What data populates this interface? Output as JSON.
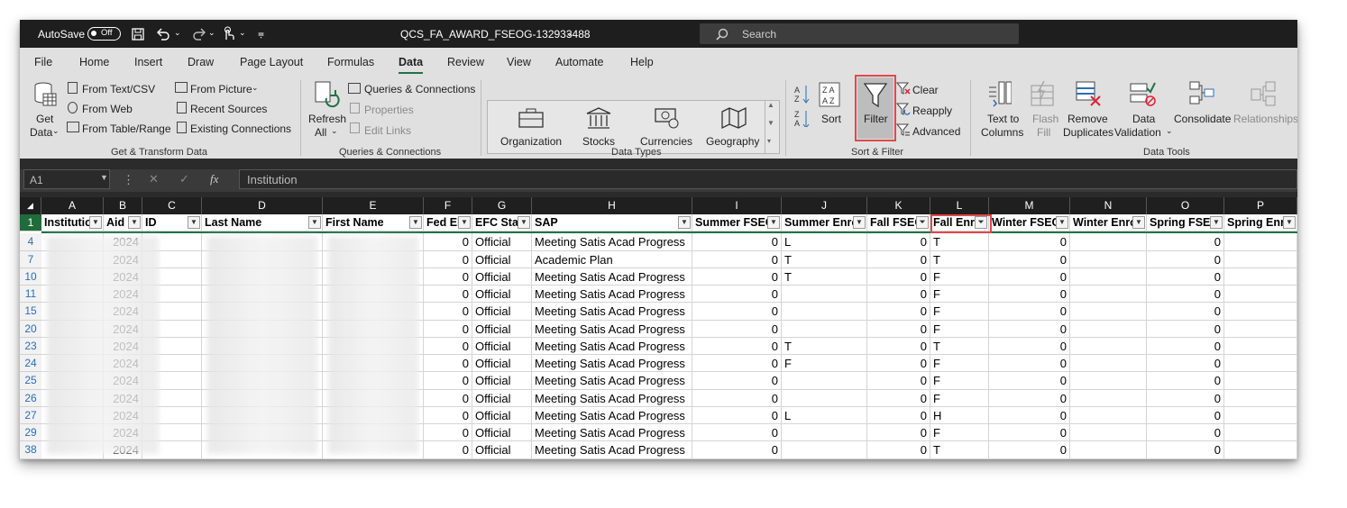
{
  "titlebar": {
    "autosave_label": "AutoSave",
    "autosave_state": "Off",
    "filename": "QCS_FA_AWARD_FSEOG-132933488",
    "search_placeholder": "Search"
  },
  "menu": [
    "File",
    "Home",
    "Insert",
    "Draw",
    "Page Layout",
    "Formulas",
    "Data",
    "Review",
    "View",
    "Automate",
    "Help"
  ],
  "active_tab": "Data",
  "ribbon": {
    "get_transform": {
      "get_data": "Get",
      "get_data2": "Data",
      "from_text_csv": "From Text/CSV",
      "from_web": "From Web",
      "from_table_range": "From Table/Range",
      "from_picture": "From Picture",
      "recent_sources": "Recent Sources",
      "existing_connections": "Existing Connections",
      "label": "Get & Transform Data"
    },
    "queries": {
      "refresh": "Refresh",
      "refresh2": "All",
      "queries_connections": "Queries & Connections",
      "properties": "Properties",
      "edit_links": "Edit Links",
      "label": "Queries & Connections"
    },
    "data_types": {
      "items": [
        "Organization",
        "Stocks",
        "Currencies",
        "Geography"
      ],
      "label": "Data Types"
    },
    "sort_filter": {
      "sort": "Sort",
      "filter": "Filter",
      "clear": "Clear",
      "reapply": "Reapply",
      "advanced": "Advanced",
      "label": "Sort & Filter"
    },
    "data_tools": {
      "text_to_columns": "Text to",
      "text_to_columns2": "Columns",
      "flash_fill": "Flash",
      "flash_fill2": "Fill",
      "remove_duplicates": "Remove",
      "remove_duplicates2": "Duplicates",
      "data_validation": "Data",
      "data_validation2": "Validation",
      "consolidate": "Consolidate",
      "relationships": "Relationships",
      "label": "Data Tools"
    }
  },
  "formula_bar": {
    "name_box": "A1",
    "fx": "fx",
    "content": "Institution"
  },
  "columns": [
    "A",
    "B",
    "C",
    "D",
    "E",
    "F",
    "G",
    "H",
    "I",
    "J",
    "K",
    "L",
    "M",
    "N",
    "O",
    "P"
  ],
  "headers": [
    "Institutio",
    "Aid",
    "ID",
    "Last Name",
    "First Name",
    "Fed El",
    "EFC Stat",
    "SAP",
    "Summer FSEO",
    "Summer Enro",
    "Fall FSEO",
    "Fall Enro",
    "Winter FSEO",
    "Winter Enro",
    "Spring FSEO",
    "Spring Enro"
  ],
  "header_row_num": "1",
  "rows": [
    {
      "n": "4",
      "aid": "2024",
      "fed": "0",
      "efc": "Official",
      "sap": "Meeting Satis Acad Progress",
      "sf": "0",
      "se": "L",
      "ff": "0",
      "fe": "T",
      "wf": "0",
      "spf": "0"
    },
    {
      "n": "7",
      "aid": "2024",
      "fed": "0",
      "efc": "Official",
      "sap": "Academic Plan",
      "sf": "0",
      "se": "T",
      "ff": "0",
      "fe": "T",
      "wf": "0",
      "spf": "0"
    },
    {
      "n": "10",
      "aid": "2024",
      "fed": "0",
      "efc": "Official",
      "sap": "Meeting Satis Acad Progress",
      "sf": "0",
      "se": "T",
      "ff": "0",
      "fe": "F",
      "wf": "0",
      "spf": "0"
    },
    {
      "n": "11",
      "aid": "2024",
      "fed": "0",
      "efc": "Official",
      "sap": "Meeting Satis Acad Progress",
      "sf": "0",
      "se": "",
      "ff": "0",
      "fe": "F",
      "wf": "0",
      "spf": "0"
    },
    {
      "n": "15",
      "aid": "2024",
      "fed": "0",
      "efc": "Official",
      "sap": "Meeting Satis Acad Progress",
      "sf": "0",
      "se": "",
      "ff": "0",
      "fe": "F",
      "wf": "0",
      "spf": "0"
    },
    {
      "n": "20",
      "aid": "2024",
      "fed": "0",
      "efc": "Official",
      "sap": "Meeting Satis Acad Progress",
      "sf": "0",
      "se": "",
      "ff": "0",
      "fe": "F",
      "wf": "0",
      "spf": "0"
    },
    {
      "n": "23",
      "aid": "2024",
      "fed": "0",
      "efc": "Official",
      "sap": "Meeting Satis Acad Progress",
      "sf": "0",
      "se": "T",
      "ff": "0",
      "fe": "T",
      "wf": "0",
      "spf": "0"
    },
    {
      "n": "24",
      "aid": "2024",
      "fed": "0",
      "efc": "Official",
      "sap": "Meeting Satis Acad Progress",
      "sf": "0",
      "se": "F",
      "ff": "0",
      "fe": "F",
      "wf": "0",
      "spf": "0"
    },
    {
      "n": "25",
      "aid": "2024",
      "fed": "0",
      "efc": "Official",
      "sap": "Meeting Satis Acad Progress",
      "sf": "0",
      "se": "",
      "ff": "0",
      "fe": "F",
      "wf": "0",
      "spf": "0"
    },
    {
      "n": "26",
      "aid": "2024",
      "fed": "0",
      "efc": "Official",
      "sap": "Meeting Satis Acad Progress",
      "sf": "0",
      "se": "",
      "ff": "0",
      "fe": "F",
      "wf": "0",
      "spf": "0"
    },
    {
      "n": "27",
      "aid": "2024",
      "fed": "0",
      "efc": "Official",
      "sap": "Meeting Satis Acad Progress",
      "sf": "0",
      "se": "L",
      "ff": "0",
      "fe": "H",
      "wf": "0",
      "spf": "0"
    },
    {
      "n": "29",
      "aid": "2024",
      "fed": "0",
      "efc": "Official",
      "sap": "Meeting Satis Acad Progress",
      "sf": "0",
      "se": "",
      "ff": "0",
      "fe": "F",
      "wf": "0",
      "spf": "0"
    },
    {
      "n": "38",
      "aid": "2024",
      "fed": "0",
      "efc": "Official",
      "sap": "Meeting Satis Acad Progress",
      "sf": "0",
      "se": "",
      "ff": "0",
      "fe": "T",
      "wf": "0",
      "spf": "0"
    }
  ],
  "colors": {
    "accent": "#217346",
    "highlight": "#e0494b",
    "rownum": "#2e6db4"
  }
}
